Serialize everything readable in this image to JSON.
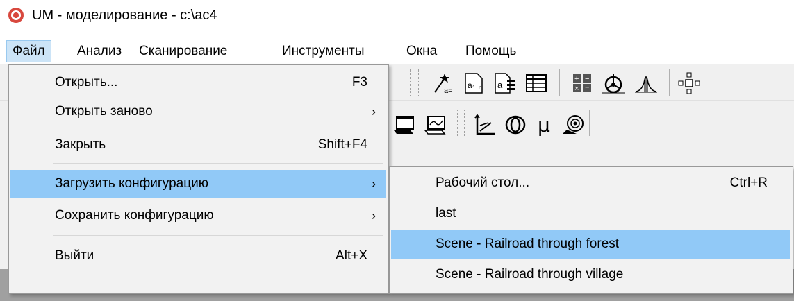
{
  "window": {
    "title": "UM - моделирование - c:\\ac4"
  },
  "menubar": {
    "items": [
      {
        "label": "Файл"
      },
      {
        "label": "Анализ"
      },
      {
        "label": "Сканирование"
      },
      {
        "label": "Инструменты"
      },
      {
        "label": "Окна"
      },
      {
        "label": "Помощь"
      }
    ]
  },
  "file_menu": {
    "items": [
      {
        "label": "Открыть...",
        "shortcut": "F3"
      },
      {
        "label": "Открыть заново",
        "arrow": "›"
      },
      {
        "label": "Закрыть",
        "shortcut": "Shift+F4"
      },
      {
        "label": "Загрузить конфигурацию",
        "arrow": "›"
      },
      {
        "label": "Сохранить конфигурацию",
        "arrow": "›"
      },
      {
        "label": "Выйти",
        "shortcut": "Alt+X"
      }
    ]
  },
  "config_submenu": {
    "items": [
      {
        "label": "Рабочий стол...",
        "shortcut": "Ctrl+R"
      },
      {
        "label": "last"
      },
      {
        "label": "Scene - Railroad through forest"
      },
      {
        "label": "Scene - Railroad through village"
      }
    ]
  },
  "toolbar": {
    "row1": [
      "wand-icon",
      "param-a1n-icon",
      "param-a-list-icon",
      "table-icon",
      "calculator-icon",
      "wheel-icon",
      "spectrum-icon",
      "expand-icon"
    ],
    "row2": [
      "window-export-icon",
      "window-plot-icon",
      "graph-axes-icon",
      "orbit-icon",
      "mu-icon",
      "eye-target-icon"
    ]
  },
  "colors": {
    "menu_highlight": "#91c9f7",
    "menubar_active": "#cce4f7",
    "app_icon": "#d8483e"
  }
}
